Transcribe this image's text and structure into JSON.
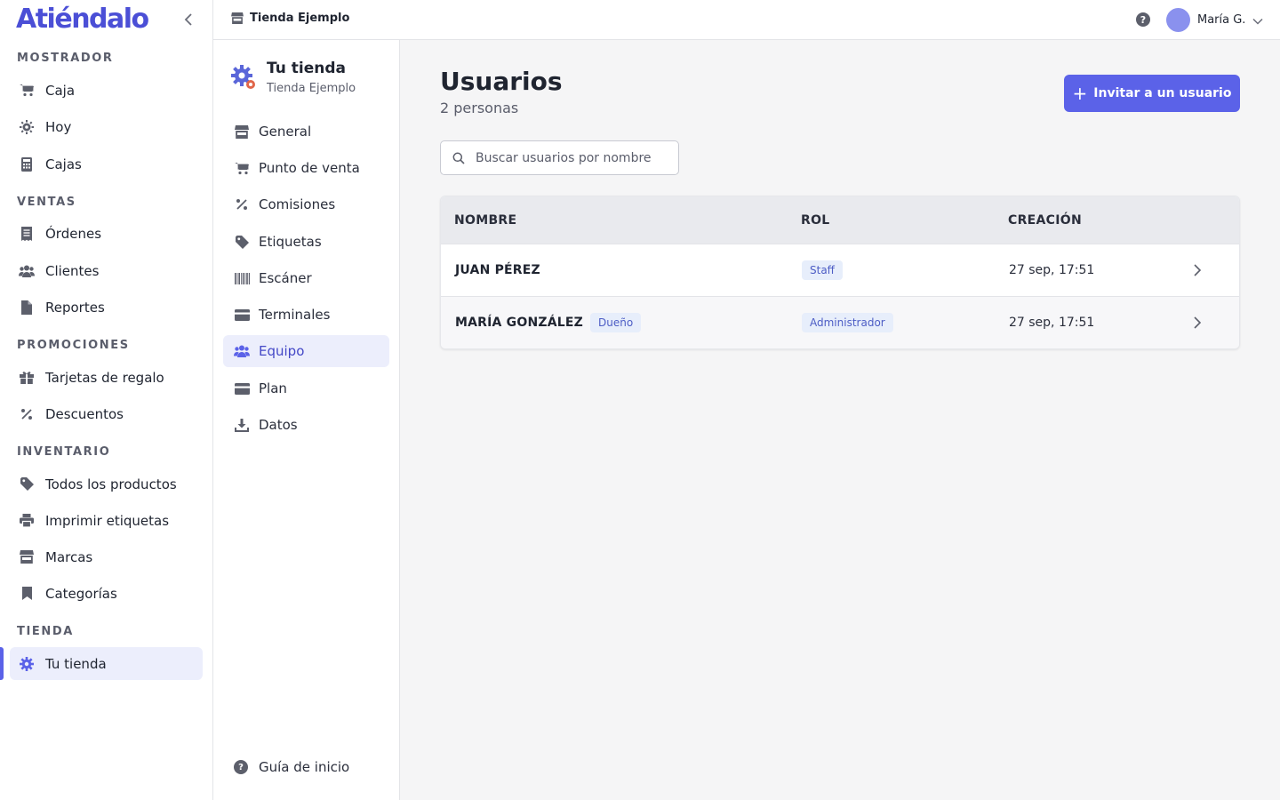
{
  "brand": "Atiéndalo",
  "sidebar": {
    "sections": [
      {
        "title": "MOSTRADOR",
        "items": [
          {
            "label": "Caja",
            "icon": "cart-icon"
          },
          {
            "label": "Hoy",
            "icon": "sun-icon"
          },
          {
            "label": "Cajas",
            "icon": "calculator-icon"
          }
        ]
      },
      {
        "title": "VENTAS",
        "items": [
          {
            "label": "Órdenes",
            "icon": "receipt-icon"
          },
          {
            "label": "Clientes",
            "icon": "users-icon"
          },
          {
            "label": "Reportes",
            "icon": "file-icon"
          }
        ]
      },
      {
        "title": "PROMOCIONES",
        "items": [
          {
            "label": "Tarjetas de regalo",
            "icon": "gift-icon"
          },
          {
            "label": "Descuentos",
            "icon": "percent-icon"
          }
        ]
      },
      {
        "title": "INVENTARIO",
        "items": [
          {
            "label": "Todos los productos",
            "icon": "tag-icon"
          },
          {
            "label": "Imprimir etiquetas",
            "icon": "printer-icon"
          },
          {
            "label": "Marcas",
            "icon": "store-icon"
          },
          {
            "label": "Categorías",
            "icon": "bookmark-icon"
          }
        ]
      },
      {
        "title": "TIENDA",
        "items": [
          {
            "label": "Tu tienda",
            "icon": "gear-icon",
            "active": true
          }
        ]
      }
    ]
  },
  "header": {
    "store_name": "Tienda Ejemplo",
    "help": "?",
    "user_name": "María G."
  },
  "subnav": {
    "title": "Tu tienda",
    "subtitle": "Tienda Ejemplo",
    "items": [
      {
        "label": "General",
        "icon": "store-icon"
      },
      {
        "label": "Punto de venta",
        "icon": "cart-icon"
      },
      {
        "label": "Comisiones",
        "icon": "percent-icon"
      },
      {
        "label": "Etiquetas",
        "icon": "tag-icon"
      },
      {
        "label": "Escáner",
        "icon": "barcode-icon"
      },
      {
        "label": "Terminales",
        "icon": "credit-card-icon"
      },
      {
        "label": "Equipo",
        "icon": "users-icon",
        "active": true
      },
      {
        "label": "Plan",
        "icon": "credit-card-icon"
      },
      {
        "label": "Datos",
        "icon": "download-icon"
      }
    ],
    "footer_label": "Guía de inicio"
  },
  "main": {
    "title": "Usuarios",
    "subtitle": "2 personas",
    "invite_label": "Invitar a un usuario",
    "search_placeholder": "Buscar usuarios por nombre",
    "columns": [
      "NOMBRE",
      "ROL",
      "CREACIÓN"
    ],
    "rows": [
      {
        "name": "JUAN PÉREZ",
        "badge": "",
        "role": "Staff",
        "created": "27 sep, 17:51"
      },
      {
        "name": "MARÍA GONZÁLEZ",
        "badge": "Dueño",
        "role": "Administrador",
        "created": "27 sep, 17:51"
      }
    ]
  },
  "colors": {
    "accent": "#5b62e8",
    "brand": "#4b4fd6",
    "active_bg": "#eceefc"
  }
}
